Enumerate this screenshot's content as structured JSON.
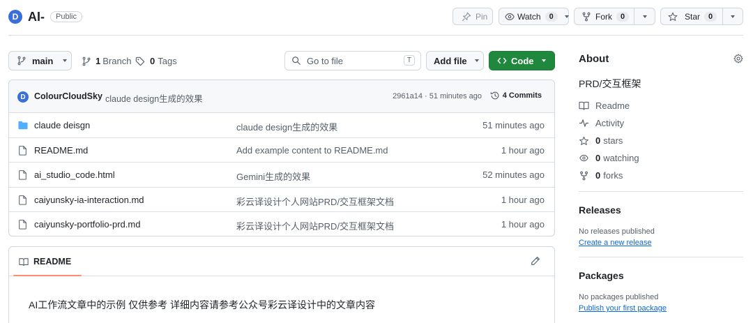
{
  "repo": {
    "owner_avatar_letter": "D",
    "name": "AI-",
    "visibility": "Public"
  },
  "actions": {
    "pin_label": "Pin",
    "watch_label": "Watch",
    "watch_count": "0",
    "fork_label": "Fork",
    "fork_count": "0",
    "star_label": "Star",
    "star_count": "0"
  },
  "toolbar": {
    "branch": "main",
    "branch_count": "1",
    "branch_label": "Branch",
    "tag_count": "0",
    "tag_label": "Tags",
    "search_placeholder": "Go to file",
    "search_shortcut": "T",
    "add_file_label": "Add file",
    "code_label": "Code"
  },
  "latest_commit": {
    "avatar_letter": "D",
    "author": "ColourCloudSky",
    "message": "claude design生成的效果",
    "hash_time": "2961a14 · 51 minutes ago",
    "commits_label": "4 Commits"
  },
  "files": [
    {
      "type": "folder",
      "name": "claude deisgn",
      "message": "claude design生成的效果",
      "time": "51 minutes ago"
    },
    {
      "type": "file",
      "name": "README.md",
      "message": "Add example content to README.md",
      "time": "1 hour ago"
    },
    {
      "type": "file",
      "name": "ai_studio_code.html",
      "message": "Gemini生成的效果",
      "time": "52 minutes ago"
    },
    {
      "type": "file",
      "name": "caiyunsky-ia-interaction.md",
      "message": "彩云译设计个人网站PRD/交互框架文档",
      "time": "1 hour ago"
    },
    {
      "type": "file",
      "name": "caiyunsky-portfolio-prd.md",
      "message": "彩云译设计个人网站PRD/交互框架文档",
      "time": "1 hour ago"
    }
  ],
  "readme": {
    "tab_label": "README",
    "content": "AI工作流文章中的示例 仅供参考 详细内容请参考公众号彩云译设计中的文章内容"
  },
  "about": {
    "heading": "About",
    "description": "PRD/交互框架",
    "readme": "Readme",
    "activity": "Activity",
    "stars_count": "0",
    "stars_label": "stars",
    "watching_count": "0",
    "watching_label": "watching",
    "forks_count": "0",
    "forks_label": "forks"
  },
  "releases": {
    "heading": "Releases",
    "empty": "No releases published",
    "link": "Create a new release"
  },
  "packages": {
    "heading": "Packages",
    "empty": "No packages published",
    "link": "Publish your first package"
  },
  "colors": {
    "accent": "#0969da",
    "code_button": "#1f883d",
    "border": "#d0d7de",
    "folder": "#54aeff",
    "readme_underline": "#fd8c73"
  }
}
